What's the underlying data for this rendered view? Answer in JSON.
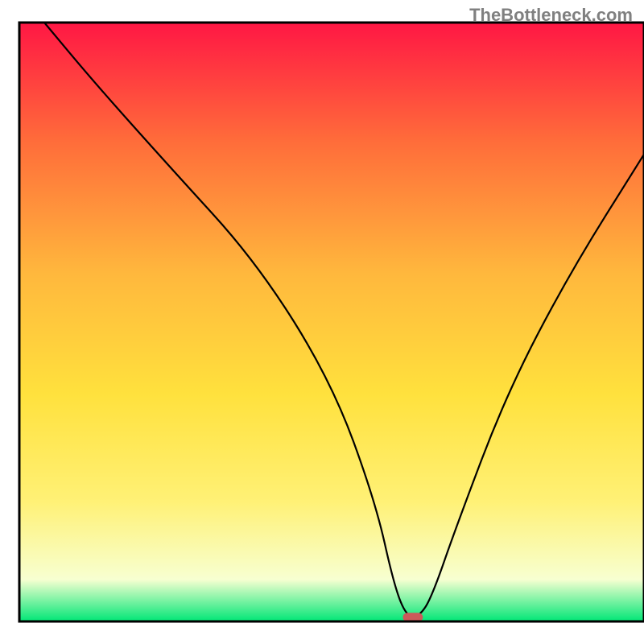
{
  "watermark": "TheBottleneck.com",
  "chart_data": {
    "type": "line",
    "title": "",
    "xlabel": "",
    "ylabel": "",
    "xlim": [
      0,
      100
    ],
    "ylim": [
      0,
      100
    ],
    "background_gradient": {
      "top": "#ff1744",
      "mid_upper": "#ff6d3a",
      "mid": "#ffb83d",
      "mid_lower": "#ffe13d",
      "lower": "#fff176",
      "base": "#f7ffd1",
      "bottom": "#00e676"
    },
    "series": [
      {
        "name": "bottleneck-curve",
        "x": [
          4,
          12,
          24,
          38,
          50,
          57,
          60,
          62,
          64,
          66,
          70,
          78,
          88,
          100
        ],
        "y": [
          100,
          90,
          76,
          60,
          40,
          20,
          6,
          0.8,
          0.8,
          4,
          16,
          38,
          58,
          78
        ]
      }
    ],
    "marker": {
      "name": "optimal-point",
      "x": 63,
      "y": 0.7,
      "color": "#cc5a5a",
      "width": 3.2,
      "height": 1.5
    },
    "frame": {
      "x": 3,
      "y": 3.5,
      "width": 97,
      "height": 93
    }
  }
}
